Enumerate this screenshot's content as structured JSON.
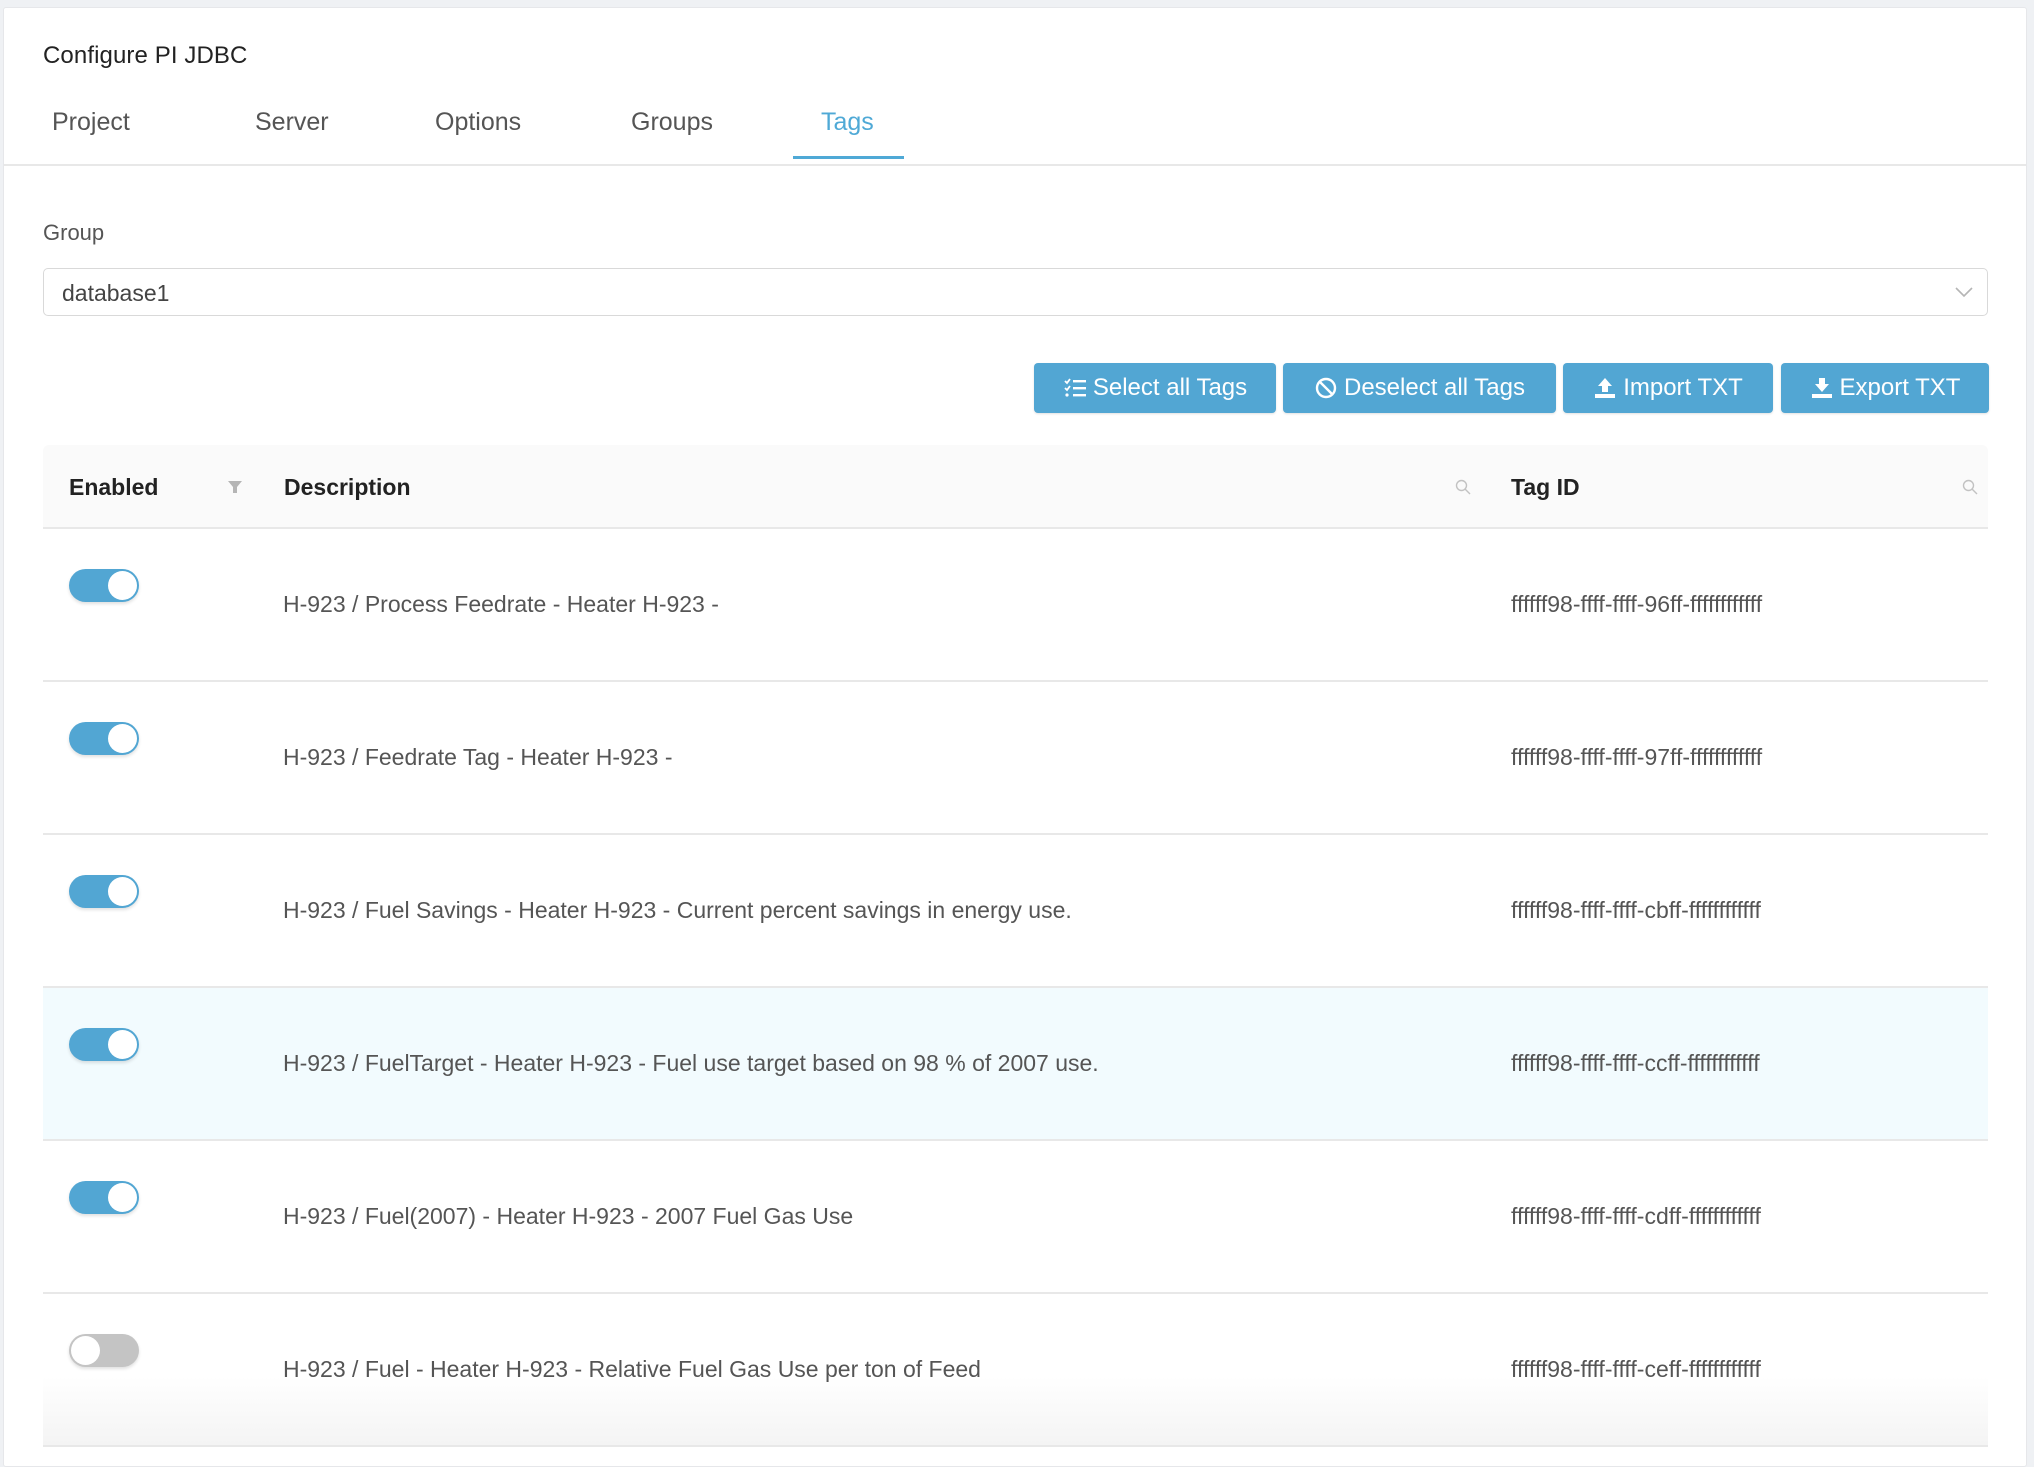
{
  "header": {
    "title": "Configure PI JDBC"
  },
  "tabs": [
    {
      "label": "Project",
      "active": false
    },
    {
      "label": "Server",
      "active": false
    },
    {
      "label": "Options",
      "active": false
    },
    {
      "label": "Groups",
      "active": false
    },
    {
      "label": "Tags",
      "active": true
    }
  ],
  "group": {
    "label": "Group",
    "selected": "database1",
    "chevron_icon": "chevron-down-icon"
  },
  "toolbar": {
    "select_all": {
      "label": "Select all Tags",
      "icon": "checklist-icon"
    },
    "deselect_all": {
      "label": "Deselect all Tags",
      "icon": "ban-icon"
    },
    "import": {
      "label": "Import TXT",
      "icon": "upload-icon"
    },
    "export": {
      "label": "Export TXT",
      "icon": "download-icon"
    }
  },
  "table": {
    "columns": [
      {
        "label": "Enabled",
        "icon": "filter-icon"
      },
      {
        "label": "Description",
        "icon": "search-icon"
      },
      {
        "label": "Tag ID",
        "icon": "search-icon"
      }
    ],
    "rows": [
      {
        "enabled": true,
        "description": "H-923 / Process Feedrate - Heater H-923 -",
        "tag_id": "ffffff98-ffff-ffff-96ff-ffffffffffff",
        "highlighted": false
      },
      {
        "enabled": true,
        "description": "H-923 / Feedrate Tag - Heater H-923 -",
        "tag_id": "ffffff98-ffff-ffff-97ff-ffffffffffff",
        "highlighted": false
      },
      {
        "enabled": true,
        "description": "H-923 / Fuel Savings - Heater H-923 - Current percent savings in energy use.",
        "tag_id": "ffffff98-ffff-ffff-cbff-ffffffffffff",
        "highlighted": false
      },
      {
        "enabled": true,
        "description": "H-923 / FuelTarget - Heater H-923 - Fuel use target based on 98 % of 2007 use.",
        "tag_id": "ffffff98-ffff-ffff-ccff-ffffffffffff",
        "highlighted": true
      },
      {
        "enabled": true,
        "description": "H-923 / Fuel(2007) - Heater H-923 - 2007 Fuel Gas Use",
        "tag_id": "ffffff98-ffff-ffff-cdff-ffffffffffff",
        "highlighted": false
      },
      {
        "enabled": false,
        "description": "H-923 / Fuel - Heater H-923 - Relative Fuel Gas Use per ton of Feed",
        "tag_id": "ffffff98-ffff-ffff-ceff-ffffffffffff",
        "highlighted": false
      }
    ]
  },
  "colors": {
    "accent": "#52a6d3",
    "active_tab": "#4fa9d6",
    "toggle_off": "#c4c4c4",
    "row_highlight": "#f2fbfe",
    "page_bg": "#eff1f4"
  }
}
